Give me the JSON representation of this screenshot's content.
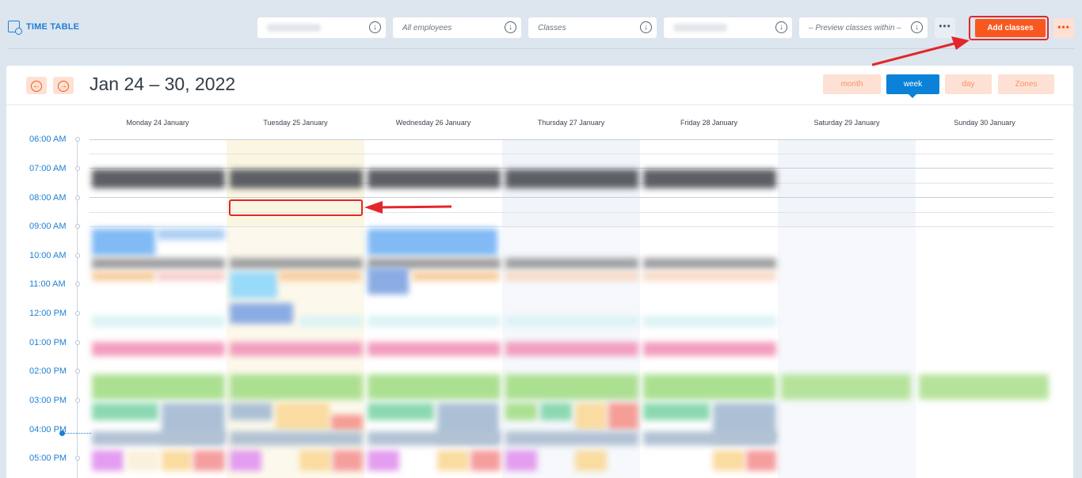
{
  "header": {
    "title": "TIME TABLE",
    "filters": [
      {
        "value": "",
        "blurred": true
      },
      {
        "value": "All employees",
        "blurred": false
      },
      {
        "value": "Classes",
        "blurred": false
      },
      {
        "value": "",
        "blurred": true
      },
      {
        "value": "– Preview classes within –",
        "blurred": false
      }
    ],
    "more_label": "•••",
    "add_classes_label": "Add classes",
    "menu_label": "•••"
  },
  "calendar": {
    "prev_icon": "←",
    "next_icon": "→",
    "date_range": "Jan 24 – 30, 2022",
    "views": [
      "month",
      "week",
      "day",
      "Zones"
    ],
    "active_view": "week",
    "days": [
      "Monday 24 January",
      "Tuesday 25 January",
      "Wednesday 26 January",
      "Thursday 27 January",
      "Friday 28 January",
      "Saturday 29 January",
      "Sunday 30 January"
    ],
    "times": [
      "06:00 AM",
      "07:00 AM",
      "08:00 AM",
      "09:00 AM",
      "10:00 AM",
      "11:00 AM",
      "12:00 PM",
      "01:00 PM",
      "02:00 PM",
      "03:00 PM",
      "04:00 PM",
      "05:00 PM"
    ],
    "current_time": "04:00 PM"
  },
  "colors": {
    "accent_orange": "#f8581f",
    "primary_blue": "#0b82d8",
    "annotation_red": "#e3262a"
  }
}
